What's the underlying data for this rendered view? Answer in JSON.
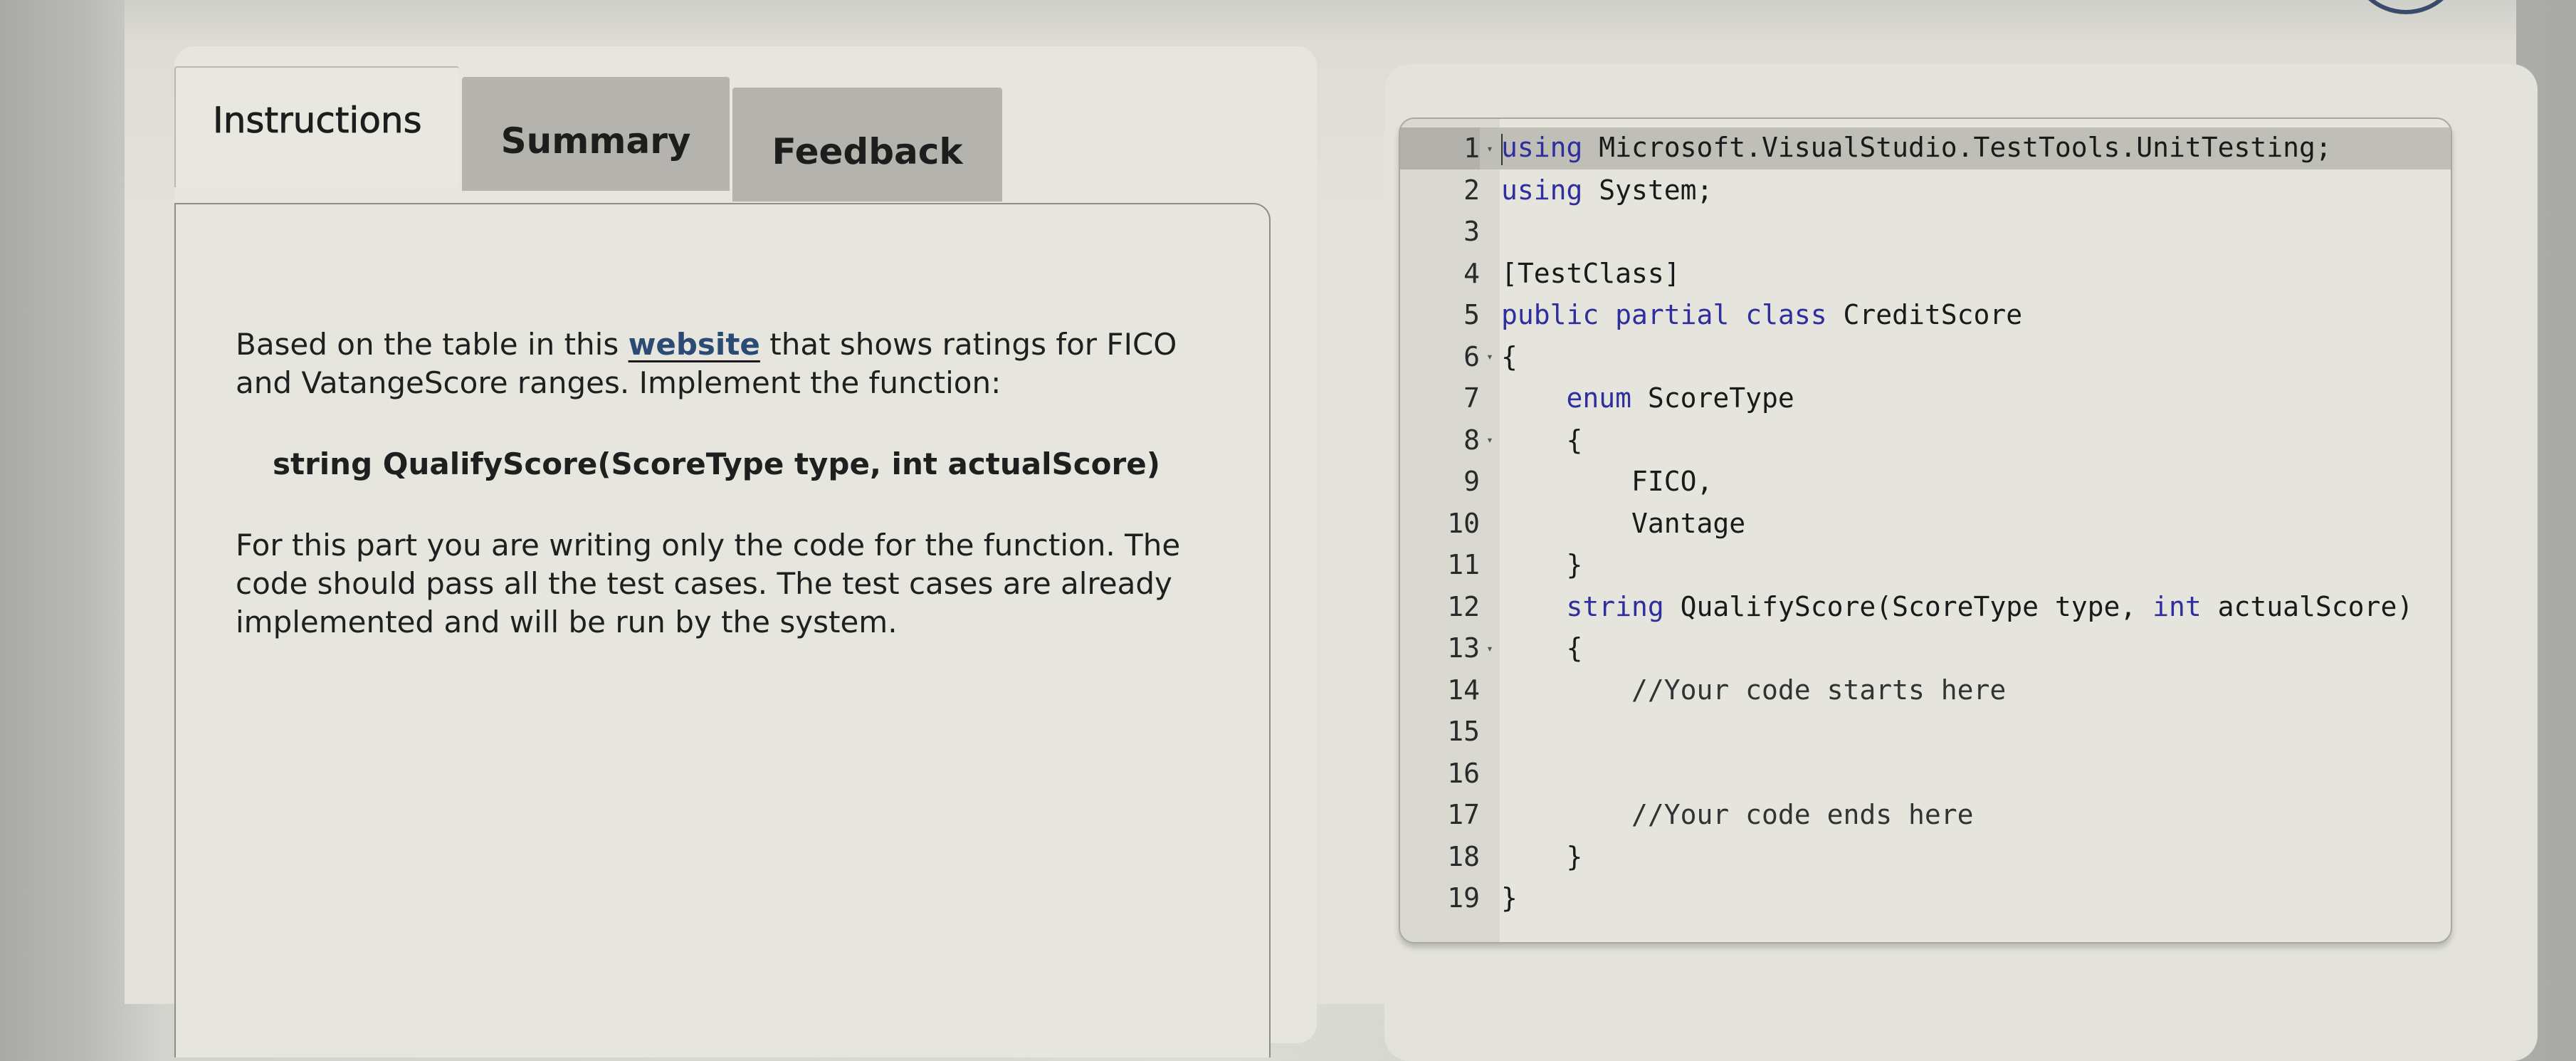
{
  "tabs": [
    {
      "label": "Instructions",
      "active": true
    },
    {
      "label": "Summary",
      "active": false
    },
    {
      "label": "Feedback",
      "active": false
    }
  ],
  "instructions": {
    "para1_before_link": "Based on the table in this ",
    "link_text": "website",
    "para1_after_link": " that shows ratings for FICO and VatangeScore ranges. Implement the function:",
    "signature": "string QualifyScore(ScoreType type, int actualScore)",
    "para2": "For this part you are writing only the code for the function. The code should pass all the test cases. The test cases are already implemented and will be run by the system."
  },
  "colors": {
    "keyword": "#2e2e9e",
    "link": "#2b4a74",
    "text": "#1f1f1f",
    "background": "#e2e1da"
  },
  "editor": {
    "active_line": 1,
    "lines": [
      {
        "n": "1",
        "fold": true,
        "tokens": [
          {
            "t": "using",
            "k": "kw"
          },
          {
            "t": " Microsoft.VisualStudio.TestTools.UnitTesting;"
          }
        ]
      },
      {
        "n": "2",
        "fold": false,
        "tokens": [
          {
            "t": "using",
            "k": "kw"
          },
          {
            "t": " System;"
          }
        ]
      },
      {
        "n": "3",
        "fold": false,
        "tokens": []
      },
      {
        "n": "4",
        "fold": false,
        "tokens": [
          {
            "t": "[TestClass]"
          }
        ]
      },
      {
        "n": "5",
        "fold": false,
        "tokens": [
          {
            "t": "public",
            "k": "kw"
          },
          {
            "t": " "
          },
          {
            "t": "partial",
            "k": "kw"
          },
          {
            "t": " "
          },
          {
            "t": "class",
            "k": "kw"
          },
          {
            "t": " CreditScore"
          }
        ]
      },
      {
        "n": "6",
        "fold": true,
        "tokens": [
          {
            "t": "{"
          }
        ]
      },
      {
        "n": "7",
        "fold": false,
        "tokens": [
          {
            "t": "    "
          },
          {
            "t": "enum",
            "k": "kw"
          },
          {
            "t": " ScoreType"
          }
        ]
      },
      {
        "n": "8",
        "fold": true,
        "tokens": [
          {
            "t": "    {"
          }
        ]
      },
      {
        "n": "9",
        "fold": false,
        "tokens": [
          {
            "t": "        FICO,"
          }
        ]
      },
      {
        "n": "10",
        "fold": false,
        "tokens": [
          {
            "t": "        Vantage"
          }
        ]
      },
      {
        "n": "11",
        "fold": false,
        "tokens": [
          {
            "t": "    }"
          }
        ]
      },
      {
        "n": "12",
        "fold": false,
        "tokens": [
          {
            "t": "    "
          },
          {
            "t": "string",
            "k": "kw"
          },
          {
            "t": " QualifyScore(ScoreType type, "
          },
          {
            "t": "int",
            "k": "kw"
          },
          {
            "t": " actualScore)"
          }
        ]
      },
      {
        "n": "13",
        "fold": true,
        "tokens": [
          {
            "t": "    {"
          }
        ]
      },
      {
        "n": "14",
        "fold": false,
        "tokens": [
          {
            "t": "        "
          },
          {
            "t": "//Your code starts here",
            "k": "comment"
          }
        ]
      },
      {
        "n": "15",
        "fold": false,
        "tokens": []
      },
      {
        "n": "16",
        "fold": false,
        "tokens": []
      },
      {
        "n": "17",
        "fold": false,
        "tokens": [
          {
            "t": "        "
          },
          {
            "t": "//Your code ends here",
            "k": "comment"
          }
        ]
      },
      {
        "n": "18",
        "fold": false,
        "tokens": [
          {
            "t": "    }"
          }
        ]
      },
      {
        "n": "19",
        "fold": false,
        "tokens": [
          {
            "t": "}"
          }
        ]
      }
    ]
  }
}
